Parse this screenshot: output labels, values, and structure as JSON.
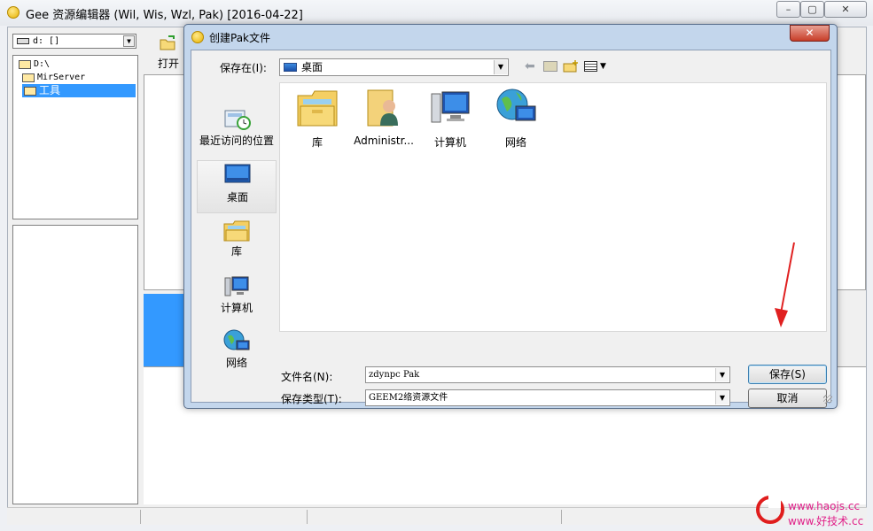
{
  "app": {
    "title": "Gee 资源编辑器 (Wil, Wis, Wzl, Pak) [2016-04-22]",
    "window_controls": {
      "minimize": "–",
      "maximize": "▢",
      "close": "✕"
    },
    "drive_combo": {
      "value": "d: []"
    },
    "tree": [
      {
        "label": "D:\\"
      },
      {
        "label": "MirServer"
      },
      {
        "label": "工具",
        "selected": true
      }
    ],
    "toolbar": {
      "open_label": "打开"
    }
  },
  "dialog": {
    "title": "创建Pak文件",
    "close_label": "✕",
    "save_in": {
      "label": "保存在(I):",
      "value": "桌面"
    },
    "places": [
      {
        "label": "最近访问的位置",
        "icon": "recent-places-icon"
      },
      {
        "label": "桌面",
        "icon": "desktop-icon",
        "selected": true
      },
      {
        "label": "库",
        "icon": "library-icon"
      },
      {
        "label": "计算机",
        "icon": "computer-icon"
      },
      {
        "label": "网络",
        "icon": "network-icon"
      }
    ],
    "files": [
      {
        "label": "库",
        "icon": "library-icon"
      },
      {
        "label": "Administr...",
        "icon": "user-folder-icon"
      },
      {
        "label": "计算机",
        "icon": "computer-icon"
      },
      {
        "label": "网络",
        "icon": "network-icon"
      }
    ],
    "filename": {
      "label": "文件名(N):",
      "value": "zdynpc Pak"
    },
    "filetype": {
      "label": "保存类型(T):",
      "value": "GEEM2络资源文件"
    },
    "buttons": {
      "save": "保存(S)",
      "cancel": "取消"
    }
  },
  "watermark": {
    "line1": "www.haojs.cc",
    "line2": "www.好技术.cc"
  },
  "colors": {
    "selection": "#3399ff",
    "close_red": "#c73d28",
    "annotation_arrow": "#e02020",
    "watermark": "#e0208a"
  }
}
